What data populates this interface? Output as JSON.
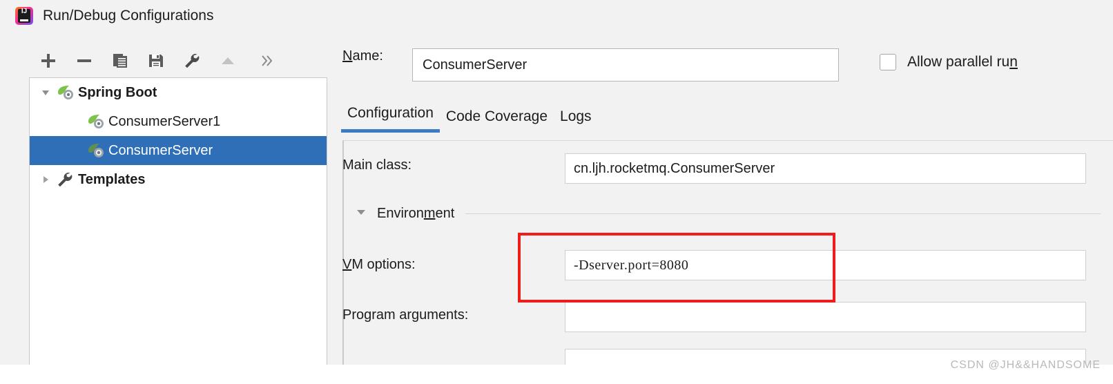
{
  "window": {
    "title": "Run/Debug Configurations",
    "app_icon": "intellij-idea-icon"
  },
  "toolbar": {
    "items": [
      {
        "name": "add-configuration-button",
        "icon": "plus-icon",
        "label": "+"
      },
      {
        "name": "remove-configuration-button",
        "icon": "minus-icon",
        "label": "−"
      },
      {
        "name": "copy-configuration-button",
        "icon": "copy-icon",
        "label": "Copy"
      },
      {
        "name": "save-configuration-button",
        "icon": "save-icon",
        "label": "Save"
      },
      {
        "name": "edit-templates-button",
        "icon": "wrench-icon",
        "label": "Edit Templates"
      },
      {
        "name": "move-up-button",
        "icon": "arrow-up-icon",
        "label": "Move Up"
      },
      {
        "name": "more-options-button",
        "icon": "chevron-double-right-icon",
        "label": "»"
      }
    ]
  },
  "tree": {
    "nodes": [
      {
        "label": "Spring Boot",
        "icon": "spring-boot-icon",
        "expanded": true,
        "bold": true,
        "depth": 0,
        "selected": false
      },
      {
        "label": "ConsumerServer1",
        "icon": "spring-boot-icon",
        "bold": false,
        "depth": 1,
        "selected": false
      },
      {
        "label": "ConsumerServer",
        "icon": "spring-boot-icon",
        "bold": false,
        "depth": 1,
        "selected": true
      },
      {
        "label": "Templates",
        "icon": "wrench-icon",
        "expanded": false,
        "bold": true,
        "depth": 0,
        "selected": false
      }
    ]
  },
  "name_field": {
    "label_prefix": "",
    "label_mnemonic": "N",
    "label_suffix": "ame:",
    "value": "ConsumerServer"
  },
  "allow_parallel_run": {
    "label_prefix": "Allow parallel ru",
    "label_mnemonic": "n",
    "label_suffix": "",
    "checked": false
  },
  "tabs": [
    {
      "label": "Configuration",
      "active": true
    },
    {
      "label": "Code Coverage",
      "active": false
    },
    {
      "label": "Logs",
      "active": false
    }
  ],
  "form": {
    "main_class": {
      "label": "Main class:",
      "value": "cn.ljh.rocketmq.ConsumerServer"
    },
    "environment_section": {
      "label_prefix": "Environ",
      "label_mnemonic": "m",
      "label_suffix": "ent",
      "expanded": true
    },
    "vm_options": {
      "label_prefix": "",
      "label_mnemonic": "V",
      "label_suffix": "M options:",
      "value": "-Dserver.port=8080"
    },
    "program_arguments": {
      "label": "Program arguments:",
      "value": ""
    },
    "next_field": {
      "value": ""
    }
  },
  "annotation": {
    "highlight_color": "#f01b1b",
    "target": "vm-options-field"
  },
  "watermark": {
    "text": "CSDN @JH&&HANDSOME"
  },
  "colors": {
    "selection_blue": "#2f6fb8",
    "tab_underline": "#3d7cc4",
    "dialog_bg": "#f2f2f2",
    "spring_green": "#6db33f"
  }
}
